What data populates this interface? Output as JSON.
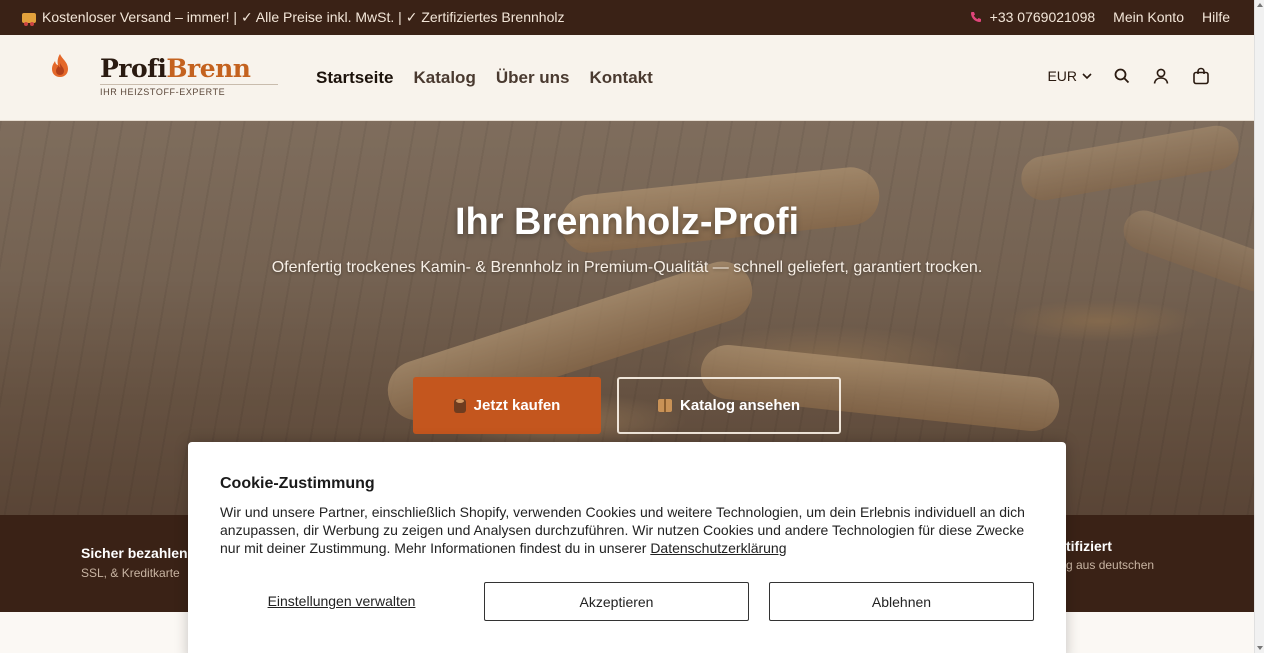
{
  "announcement": {
    "message": "Kostenloser Versand – immer! | ✓ Alle Preise inkl. MwSt. | ✓ Zertifiziertes Brennholz",
    "phone": "+33 0769021098",
    "account_link": "Mein Konto",
    "help_link": "Hilfe"
  },
  "logo": {
    "word_part1": "Profi",
    "word_part2": "Brenn",
    "tagline": "IHR HEIZSTOFF-EXPERTE"
  },
  "nav": {
    "items": [
      {
        "label": "Startseite"
      },
      {
        "label": "Katalog"
      },
      {
        "label": "Über uns"
      },
      {
        "label": "Kontakt"
      }
    ]
  },
  "tools": {
    "currency": "EUR"
  },
  "hero": {
    "title": "Ihr Brennholz-Profi",
    "subtitle": "Ofenfertig trockenes Kamin- & Brennholz in Premium-Qualität — schnell geliefert, garantiert trocken.",
    "buy_label": "Jetzt kaufen",
    "catalog_label": "Katalog ansehen"
  },
  "trust": {
    "item1_title": "Sicher bezahlen",
    "item1_sub": "SSL, & Kreditkarte",
    "item2_title": "tifiziert",
    "item2_sub": "g aus deutschen"
  },
  "cookie": {
    "title": "Cookie-Zustimmung",
    "body": "Wir und unsere Partner, einschließlich Shopify, verwenden Cookies und weitere Technologien, um dein Erlebnis individuell an dich anzupassen, dir Werbung zu zeigen und Analysen durchzuführen. Wir nutzen Cookies und andere Technologien für diese Zwecke nur mit deiner Zustimmung. Mehr Informationen findest du in unserer ",
    "privacy_link": "Datenschutzerklärung",
    "manage_label": "Einstellungen verwalten",
    "accept_label": "Akzeptieren",
    "decline_label": "Ablehnen"
  },
  "colors": {
    "brand_dark": "#3a2216",
    "brand_accent": "#c4561e",
    "header_bg": "#f8f3ec"
  }
}
